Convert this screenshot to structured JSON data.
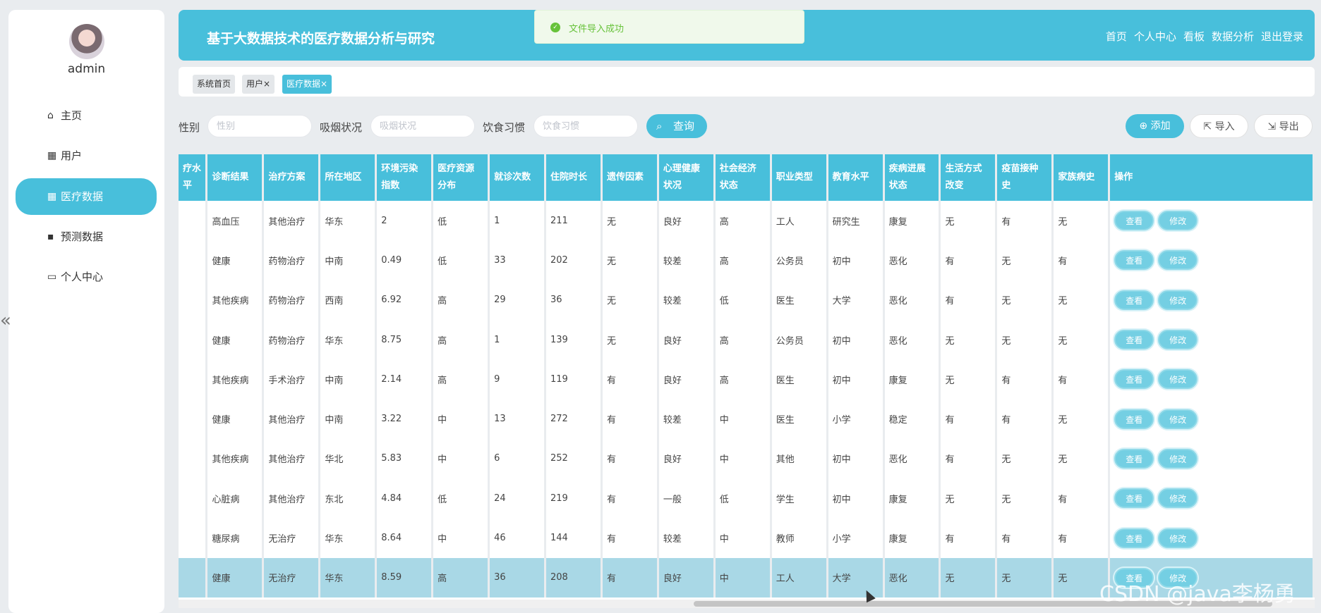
{
  "sidebar": {
    "username": "admin",
    "items": [
      {
        "label": "主页",
        "icon": "home-icon"
      },
      {
        "label": "用户",
        "icon": "grid-icon"
      },
      {
        "label": "医疗数据",
        "icon": "grid-icon",
        "active": true
      },
      {
        "label": "预测数据",
        "icon": "chat-icon"
      },
      {
        "label": "个人中心",
        "icon": "window-icon"
      }
    ]
  },
  "header": {
    "title": "基于大数据技术的医疗数据分析与研究",
    "nav": [
      "首页",
      "个人中心",
      "看板",
      "数据分析",
      "退出登录"
    ],
    "accent": "#48bfdb"
  },
  "toast": {
    "message": "文件导入成功",
    "color": "#67c23a"
  },
  "tabs": [
    {
      "label": "系统首页"
    },
    {
      "label": "用户×"
    },
    {
      "label": "医疗数据×"
    }
  ],
  "search": {
    "gender_label": "性别",
    "gender_placeholder": "性别",
    "smoking_label": "吸烟状况",
    "smoking_placeholder": "吸烟状况",
    "diet_label": "饮食习惯",
    "diet_placeholder": "饮食习惯",
    "query_label": "查询"
  },
  "actions": {
    "add": "添加",
    "import": "导入",
    "export": "导出"
  },
  "table": {
    "columns": [
      "疗水平",
      "诊断结果",
      "治疗方案",
      "所在地区",
      "环境污染指数",
      "医疗资源分布",
      "就诊次数",
      "住院时长",
      "遗传因素",
      "心理健康状况",
      "社会经济状态",
      "职业类型",
      "教育水平",
      "疾病进展状态",
      "生活方式改变",
      "疫苗接种史",
      "家族病史",
      "操作"
    ],
    "view_label": "查看",
    "edit_label": "修改",
    "rows": [
      [
        "",
        "高血压",
        "其他治疗",
        "华东",
        "2",
        "低",
        "1",
        "211",
        "无",
        "良好",
        "高",
        "工人",
        "研究生",
        "康复",
        "无",
        "有",
        "无"
      ],
      [
        "",
        "健康",
        "药物治疗",
        "中南",
        "0.49",
        "低",
        "33",
        "202",
        "无",
        "较差",
        "高",
        "公务员",
        "初中",
        "恶化",
        "有",
        "无",
        "有"
      ],
      [
        "",
        "其他疾病",
        "药物治疗",
        "西南",
        "6.92",
        "高",
        "29",
        "36",
        "无",
        "较差",
        "低",
        "医生",
        "大学",
        "恶化",
        "有",
        "无",
        "无"
      ],
      [
        "",
        "健康",
        "药物治疗",
        "华东",
        "8.75",
        "高",
        "1",
        "139",
        "无",
        "良好",
        "高",
        "公务员",
        "初中",
        "恶化",
        "无",
        "无",
        "无"
      ],
      [
        "",
        "其他疾病",
        "手术治疗",
        "中南",
        "2.14",
        "高",
        "9",
        "119",
        "有",
        "良好",
        "高",
        "医生",
        "初中",
        "康复",
        "无",
        "有",
        "有"
      ],
      [
        "",
        "健康",
        "其他治疗",
        "中南",
        "3.22",
        "中",
        "13",
        "272",
        "有",
        "较差",
        "中",
        "医生",
        "小学",
        "稳定",
        "有",
        "有",
        "无"
      ],
      [
        "",
        "其他疾病",
        "其他治疗",
        "华北",
        "5.83",
        "中",
        "6",
        "252",
        "有",
        "良好",
        "中",
        "其他",
        "初中",
        "恶化",
        "有",
        "无",
        "无"
      ],
      [
        "",
        "心脏病",
        "其他治疗",
        "东北",
        "4.84",
        "低",
        "24",
        "219",
        "有",
        "一般",
        "低",
        "学生",
        "初中",
        "康复",
        "无",
        "无",
        "有"
      ],
      [
        "",
        "糖尿病",
        "无治疗",
        "华东",
        "8.64",
        "中",
        "46",
        "144",
        "有",
        "较差",
        "中",
        "教师",
        "小学",
        "康复",
        "有",
        "有",
        "有"
      ],
      [
        "",
        "健康",
        "无治疗",
        "华东",
        "8.59",
        "高",
        "36",
        "208",
        "有",
        "良好",
        "中",
        "工人",
        "大学",
        "恶化",
        "无",
        "无",
        "无"
      ]
    ]
  },
  "watermark": "CSDN @java李杨勇"
}
